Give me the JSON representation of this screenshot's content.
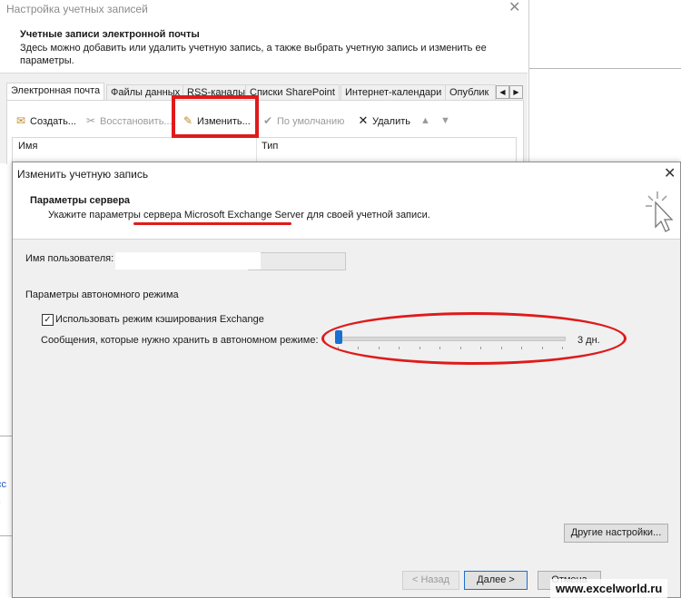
{
  "background_window": {
    "title": "Настройка учетных записей",
    "heading": "Учетные записи электронной почты",
    "description": "Здесь можно добавить или удалить учетную запись, а также выбрать учетную запись и изменить ее параметры.",
    "tabs": [
      "Электронная почта",
      "Файлы данных",
      "RSS-каналы",
      "Списки SharePoint",
      "Интернет-календари",
      "Опублик"
    ],
    "toolbar": {
      "create": "Создать...",
      "restore": "Восстановить...",
      "change": "Изменить...",
      "default": "По умолчанию",
      "delete": "Удалить"
    },
    "columns": {
      "name": "Имя",
      "type": "Тип"
    },
    "left_fragment": "cc"
  },
  "dialog": {
    "title": "Изменить учетную запись",
    "heading": "Параметры сервера",
    "subheading": "Укажите параметры сервера Microsoft Exchange Server для своей учетной записи.",
    "username_label": "Имя пользователя:",
    "username_value": "",
    "offline_section": "Параметры автономного режима",
    "cache_checkbox": {
      "label": "Использовать режим кэширования Exchange",
      "checked": true
    },
    "slider": {
      "label": "Сообщения, которые нужно хранить в автономном режиме:",
      "value_text": "3 дн.",
      "position": 0
    },
    "buttons": {
      "other": "Другие настройки...",
      "back": "< Назад",
      "next": "Далее >",
      "cancel": "Отмена"
    }
  },
  "watermark": "www.excelworld.ru",
  "annotation_color": "#e01a1a"
}
